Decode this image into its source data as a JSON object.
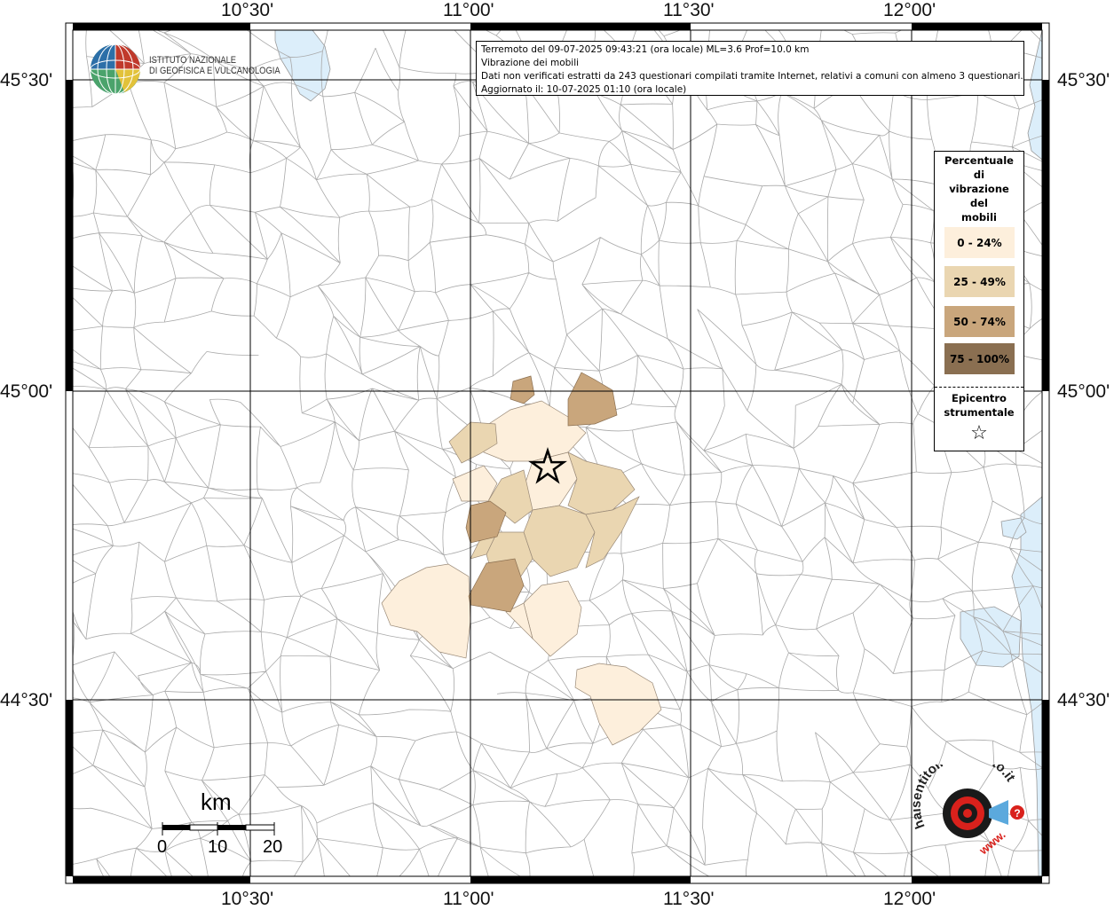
{
  "map": {
    "lon_ticks": [
      "10°30'",
      "11°00'",
      "11°30'",
      "12°00'"
    ],
    "lat_ticks": [
      "45°30'",
      "45°00'",
      "44°30'"
    ],
    "colors": {
      "water": "#dceefa",
      "boundary": "#a9a9a9",
      "grid": "#000000"
    }
  },
  "info": {
    "line1": "Terremoto del 09-07-2025 09:43:21 (ora locale) ML=3.6 Prof=10.0 km",
    "line2": "Vibrazione dei mobili",
    "line3": "Dati non verificati estratti da 243 questionari compilati tramite Internet, relativi a comuni con almeno 3 questionari.",
    "line4": "Aggiornato il: 10-07-2025 01:10 (ora locale)"
  },
  "ingv": {
    "line1": "ISTITUTO NAZIONALE",
    "line2": "DI GEOFISICA E VULCANOLOGIA"
  },
  "legend": {
    "title_lines": [
      "Percentuale",
      "di",
      "vibrazione",
      "del",
      "mobili"
    ],
    "classes": [
      {
        "label": "0 - 24%",
        "color": "#fdefdc"
      },
      {
        "label": "25 - 49%",
        "color": "#ead6b1"
      },
      {
        "label": "50 - 74%",
        "color": "#c9a67c"
      },
      {
        "label": "75 - 100%",
        "color": "#8a6f51"
      }
    ],
    "epicenter_lines": [
      "Epicentro",
      "strumentale"
    ],
    "epicenter_symbol": "☆"
  },
  "scale": {
    "unit": "km",
    "labels": [
      "0",
      "10",
      "20"
    ]
  },
  "hsit": {
    "text_top": "haisentitoilterremoto.it",
    "text_bottom": "www.",
    "question_mark": "?"
  }
}
